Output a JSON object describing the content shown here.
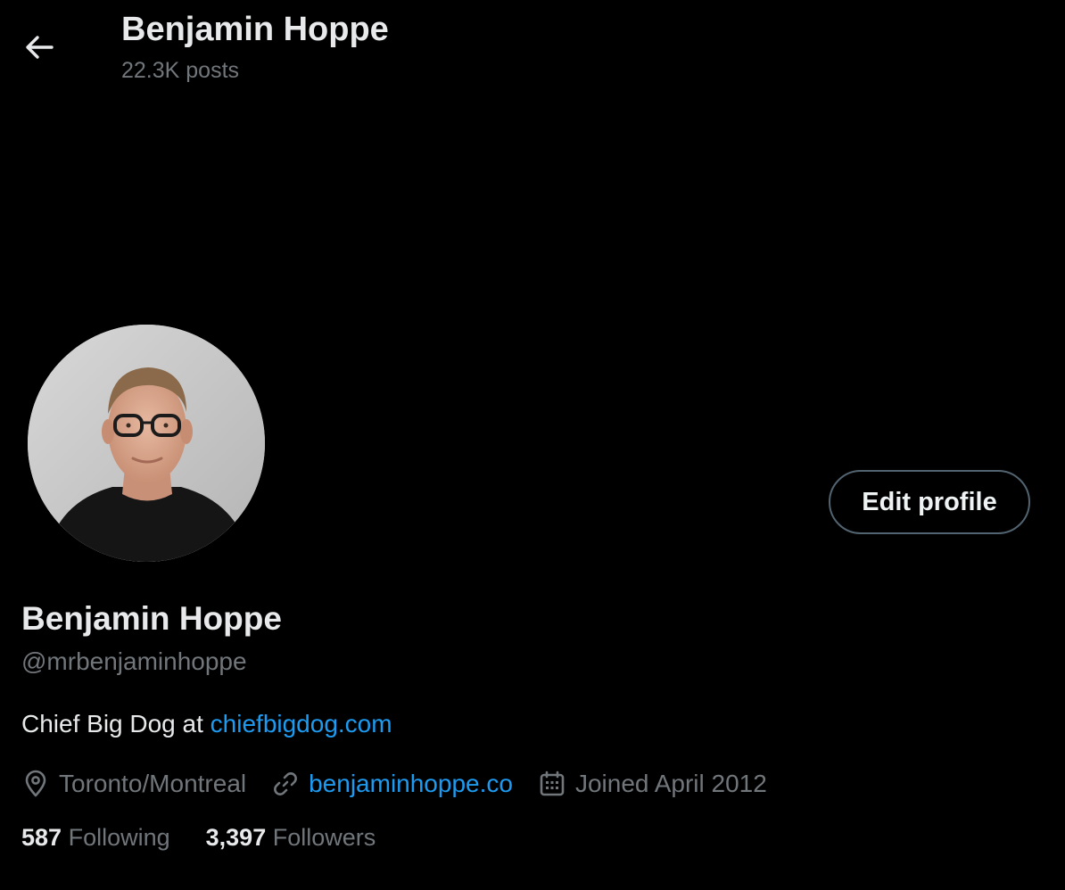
{
  "header": {
    "title": "Benjamin Hoppe",
    "post_count": "22.3K posts",
    "back_icon": "arrow-left-icon"
  },
  "profile": {
    "display_name": "Benjamin Hoppe",
    "handle": "@mrbenjaminhoppe",
    "edit_button_label": "Edit profile",
    "bio_text": "Chief Big Dog at ",
    "bio_link": "chiefbigdog.com",
    "location": "Toronto/Montreal",
    "website": "benjaminhoppe.co",
    "joined": "Joined April 2012",
    "following_count": "587",
    "following_label": "Following",
    "followers_count": "3,397",
    "followers_label": "Followers"
  },
  "colors": {
    "background": "#000000",
    "text_primary": "#e7e9ea",
    "text_secondary": "#71767b",
    "link": "#1d9bf0",
    "button_border": "#536471"
  }
}
